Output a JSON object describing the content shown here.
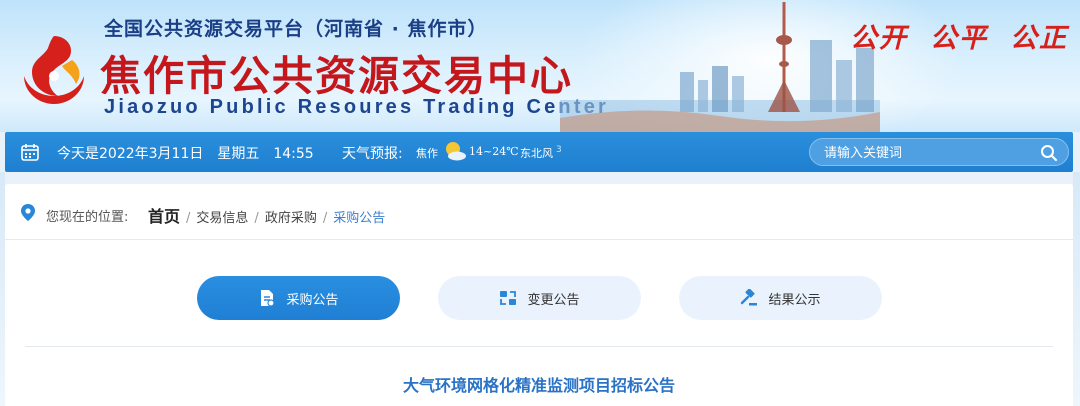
{
  "header": {
    "subtitle": "全国公共资源交易平台（河南省 · 焦作市）",
    "title": "焦作市公共资源交易中心",
    "title_en": "Jiaozuo Public Resoures Trading Center",
    "slogans": [
      "公开",
      "公平",
      "公正"
    ]
  },
  "navbar": {
    "date": "今天是2022年3月11日",
    "weekday": "星期五",
    "time": "14:55",
    "weather_label": "天气预报:",
    "city": "焦作",
    "temperature": "14~24℃",
    "wind": "东北风",
    "wind_level": "3",
    "search_placeholder": "请输入关键词"
  },
  "breadcrumb": {
    "prefix": "您现在的位置:",
    "items": [
      "首页",
      "交易信息",
      "政府采购",
      "采购公告"
    ]
  },
  "tabs": [
    {
      "label": "采购公告",
      "icon": "document-icon",
      "active": true
    },
    {
      "label": "变更公告",
      "icon": "change-icon",
      "active": false
    },
    {
      "label": "结果公示",
      "icon": "gavel-icon",
      "active": false
    }
  ],
  "article": {
    "title": "大气环境网格化精准监测项目招标公告"
  },
  "colors": {
    "primary": "#1f7fd0",
    "brand_red": "#c4171c",
    "navy": "#1b3f86",
    "link": "#3b7fd1"
  }
}
